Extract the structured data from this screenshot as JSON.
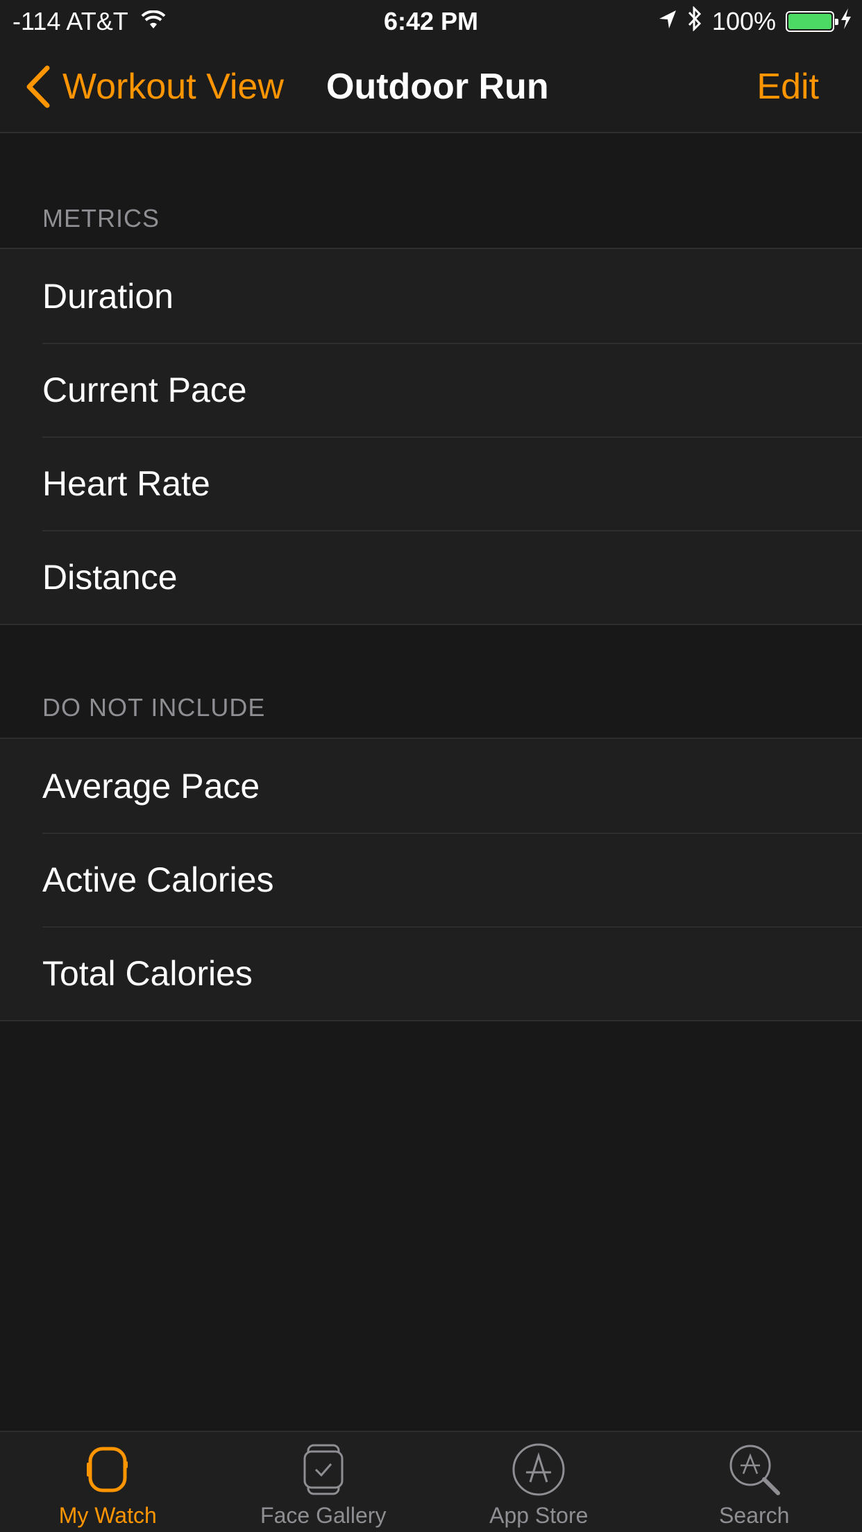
{
  "status_bar": {
    "carrier": "-114 AT&T",
    "time": "6:42 PM",
    "battery_percent": "100%",
    "battery_level": 1.0,
    "battery_color": "#4cd964"
  },
  "nav": {
    "back_label": "Workout View",
    "title": "Outdoor Run",
    "edit_label": "Edit",
    "accent_color": "#ff9500"
  },
  "sections": {
    "metrics": {
      "header": "METRICS",
      "items": [
        "Duration",
        "Current Pace",
        "Heart Rate",
        "Distance"
      ]
    },
    "do_not_include": {
      "header": "DO NOT INCLUDE",
      "items": [
        "Average Pace",
        "Active Calories",
        "Total Calories"
      ]
    }
  },
  "tabbar": {
    "tabs": [
      {
        "label": "My Watch",
        "icon": "watch-icon",
        "active": true
      },
      {
        "label": "Face Gallery",
        "icon": "face-gallery-icon",
        "active": false
      },
      {
        "label": "App Store",
        "icon": "app-store-icon",
        "active": false
      },
      {
        "label": "Search",
        "icon": "search-icon",
        "active": false
      }
    ]
  }
}
